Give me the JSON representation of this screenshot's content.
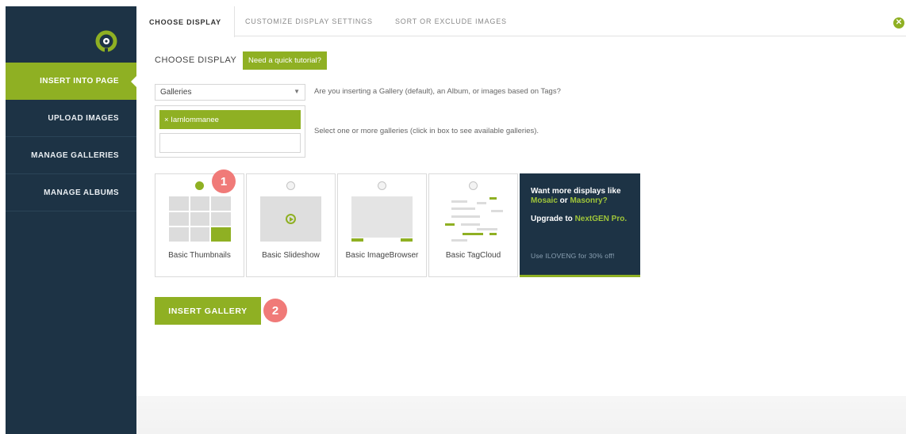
{
  "sidebar": {
    "logo_icon": "nextgen-logo-icon",
    "items": [
      {
        "label": "INSERT INTO PAGE",
        "active": true
      },
      {
        "label": "UPLOAD IMAGES",
        "active": false
      },
      {
        "label": "MANAGE GALLERIES",
        "active": false
      },
      {
        "label": "MANAGE ALBUMS",
        "active": false
      }
    ]
  },
  "tabs": [
    {
      "label": "CHOOSE DISPLAY",
      "active": true
    },
    {
      "label": "CUSTOMIZE DISPLAY SETTINGS",
      "active": false
    },
    {
      "label": "SORT OR EXCLUDE IMAGES",
      "active": false
    }
  ],
  "close_icon": "close-icon",
  "main": {
    "heading": "CHOOSE DISPLAY",
    "tutorial_button": "Need a quick tutorial?",
    "source_select": {
      "value": "Galleries",
      "help": "Are you inserting a Gallery (default), an Album, or images based on Tags?"
    },
    "galleries": {
      "selected": [
        "× Iarnlommanee"
      ],
      "help": "Select one or more galleries (click in box to see available galleries)."
    },
    "display_types": [
      {
        "label": "Basic Thumbnails",
        "checked": true
      },
      {
        "label": "Basic Slideshow",
        "checked": false
      },
      {
        "label": "Basic ImageBrowser",
        "checked": false
      },
      {
        "label": "Basic TagCloud",
        "checked": false
      }
    ],
    "promo": {
      "line1": "Want more displays like",
      "mosaic": "Mosaic",
      "or": " or ",
      "masonry": "Masonry?",
      "upgrade_prefix": "Upgrade to ",
      "upgrade_link": "NextGEN Pro.",
      "coupon": "Use ILOVENG for 30% off!"
    },
    "insert_button": "INSERT GALLERY",
    "steps": [
      "1",
      "2"
    ]
  },
  "colors": {
    "accent": "#8fb023",
    "sidebar": "#1d3345",
    "step_badge": "#f07a78"
  }
}
